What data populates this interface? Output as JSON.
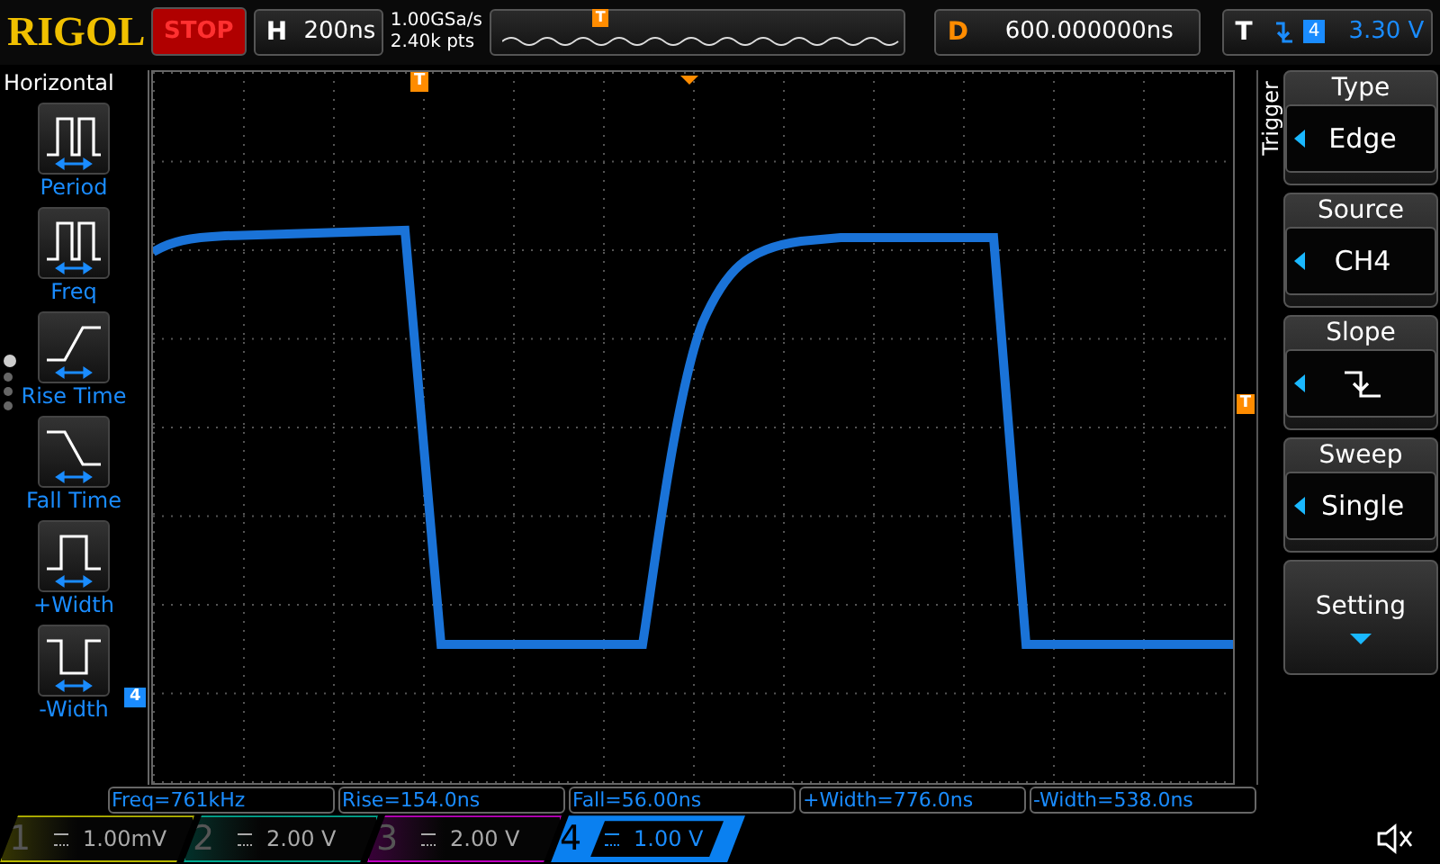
{
  "brand": "RIGOL",
  "run_state": "STOP",
  "timebase": {
    "label": "H",
    "value": "200ns"
  },
  "acquisition": {
    "sample_rate": "1.00GSa/s",
    "memory_depth": "2.40k pts"
  },
  "overview_marker": "T",
  "delay": {
    "label": "D",
    "value": "600.000000ns"
  },
  "trigger_status": {
    "label": "T",
    "source": "4",
    "level": "3.30 V"
  },
  "left_menu": {
    "title": "Horizontal",
    "items": [
      {
        "kind": "period",
        "label": "Period"
      },
      {
        "kind": "freq",
        "label": "Freq"
      },
      {
        "kind": "rise",
        "label": "Rise Time"
      },
      {
        "kind": "fall",
        "label": "Fall Time"
      },
      {
        "kind": "pwidth",
        "label": "+Width"
      },
      {
        "kind": "nwidth",
        "label": "-Width"
      }
    ],
    "page_dots": [
      {
        "selected": true
      },
      {
        "selected": false
      },
      {
        "selected": false
      },
      {
        "selected": false
      }
    ]
  },
  "screen": {
    "trigger_position_marker": "T",
    "trigger_level_marker": "T",
    "channel_marker": "4"
  },
  "right_menu": {
    "title": "Trigger",
    "items": [
      {
        "kind": "select",
        "label": "Type",
        "value": "Edge"
      },
      {
        "kind": "select",
        "label": "Source",
        "value": "CH4"
      },
      {
        "kind": "slope",
        "label": "Slope"
      },
      {
        "kind": "select",
        "label": "Sweep",
        "value": "Single"
      },
      {
        "kind": "more",
        "label": "Setting"
      }
    ]
  },
  "measurements": [
    "Freq=761kHz",
    "Rise=154.0ns",
    "Fall=56.00ns",
    "+Width=776.0ns",
    "-Width=538.0ns"
  ],
  "channels": [
    {
      "number": "1",
      "value": "1.00mV",
      "color": "#b8b800",
      "selected": false
    },
    {
      "number": "2",
      "value": "2.00 V",
      "color": "#00a890",
      "selected": false
    },
    {
      "number": "3",
      "value": "2.00 V",
      "color": "#c000c0",
      "selected": false
    },
    {
      "number": "4",
      "value": "1.00 V",
      "color": "#0a80f0",
      "selected": true
    }
  ]
}
